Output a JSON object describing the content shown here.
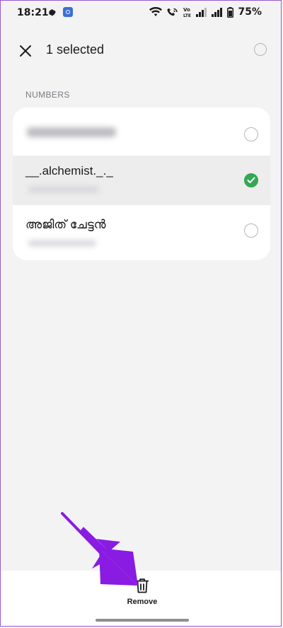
{
  "status_bar": {
    "time": "18:21",
    "battery": "75%",
    "icons": [
      "gear-icon",
      "cast-icon",
      "wifi-icon",
      "wifi-calling-icon",
      "volte-icon",
      "signal-icon",
      "signal-icon",
      "battery-icon"
    ]
  },
  "header": {
    "title": "1 selected",
    "close_icon": "close-icon"
  },
  "section": {
    "label": "NUMBERS"
  },
  "contacts": [
    {
      "name": "",
      "selected": false
    },
    {
      "name": "__.alchemist._._",
      "selected": true
    },
    {
      "name": "അജിത് ചേട്ടൻ",
      "selected": false
    }
  ],
  "bottom_bar": {
    "remove_label": "Remove",
    "remove_icon": "trash-icon"
  },
  "colors": {
    "accent_check": "#34a853",
    "annotation_arrow": "#8a1be2"
  }
}
